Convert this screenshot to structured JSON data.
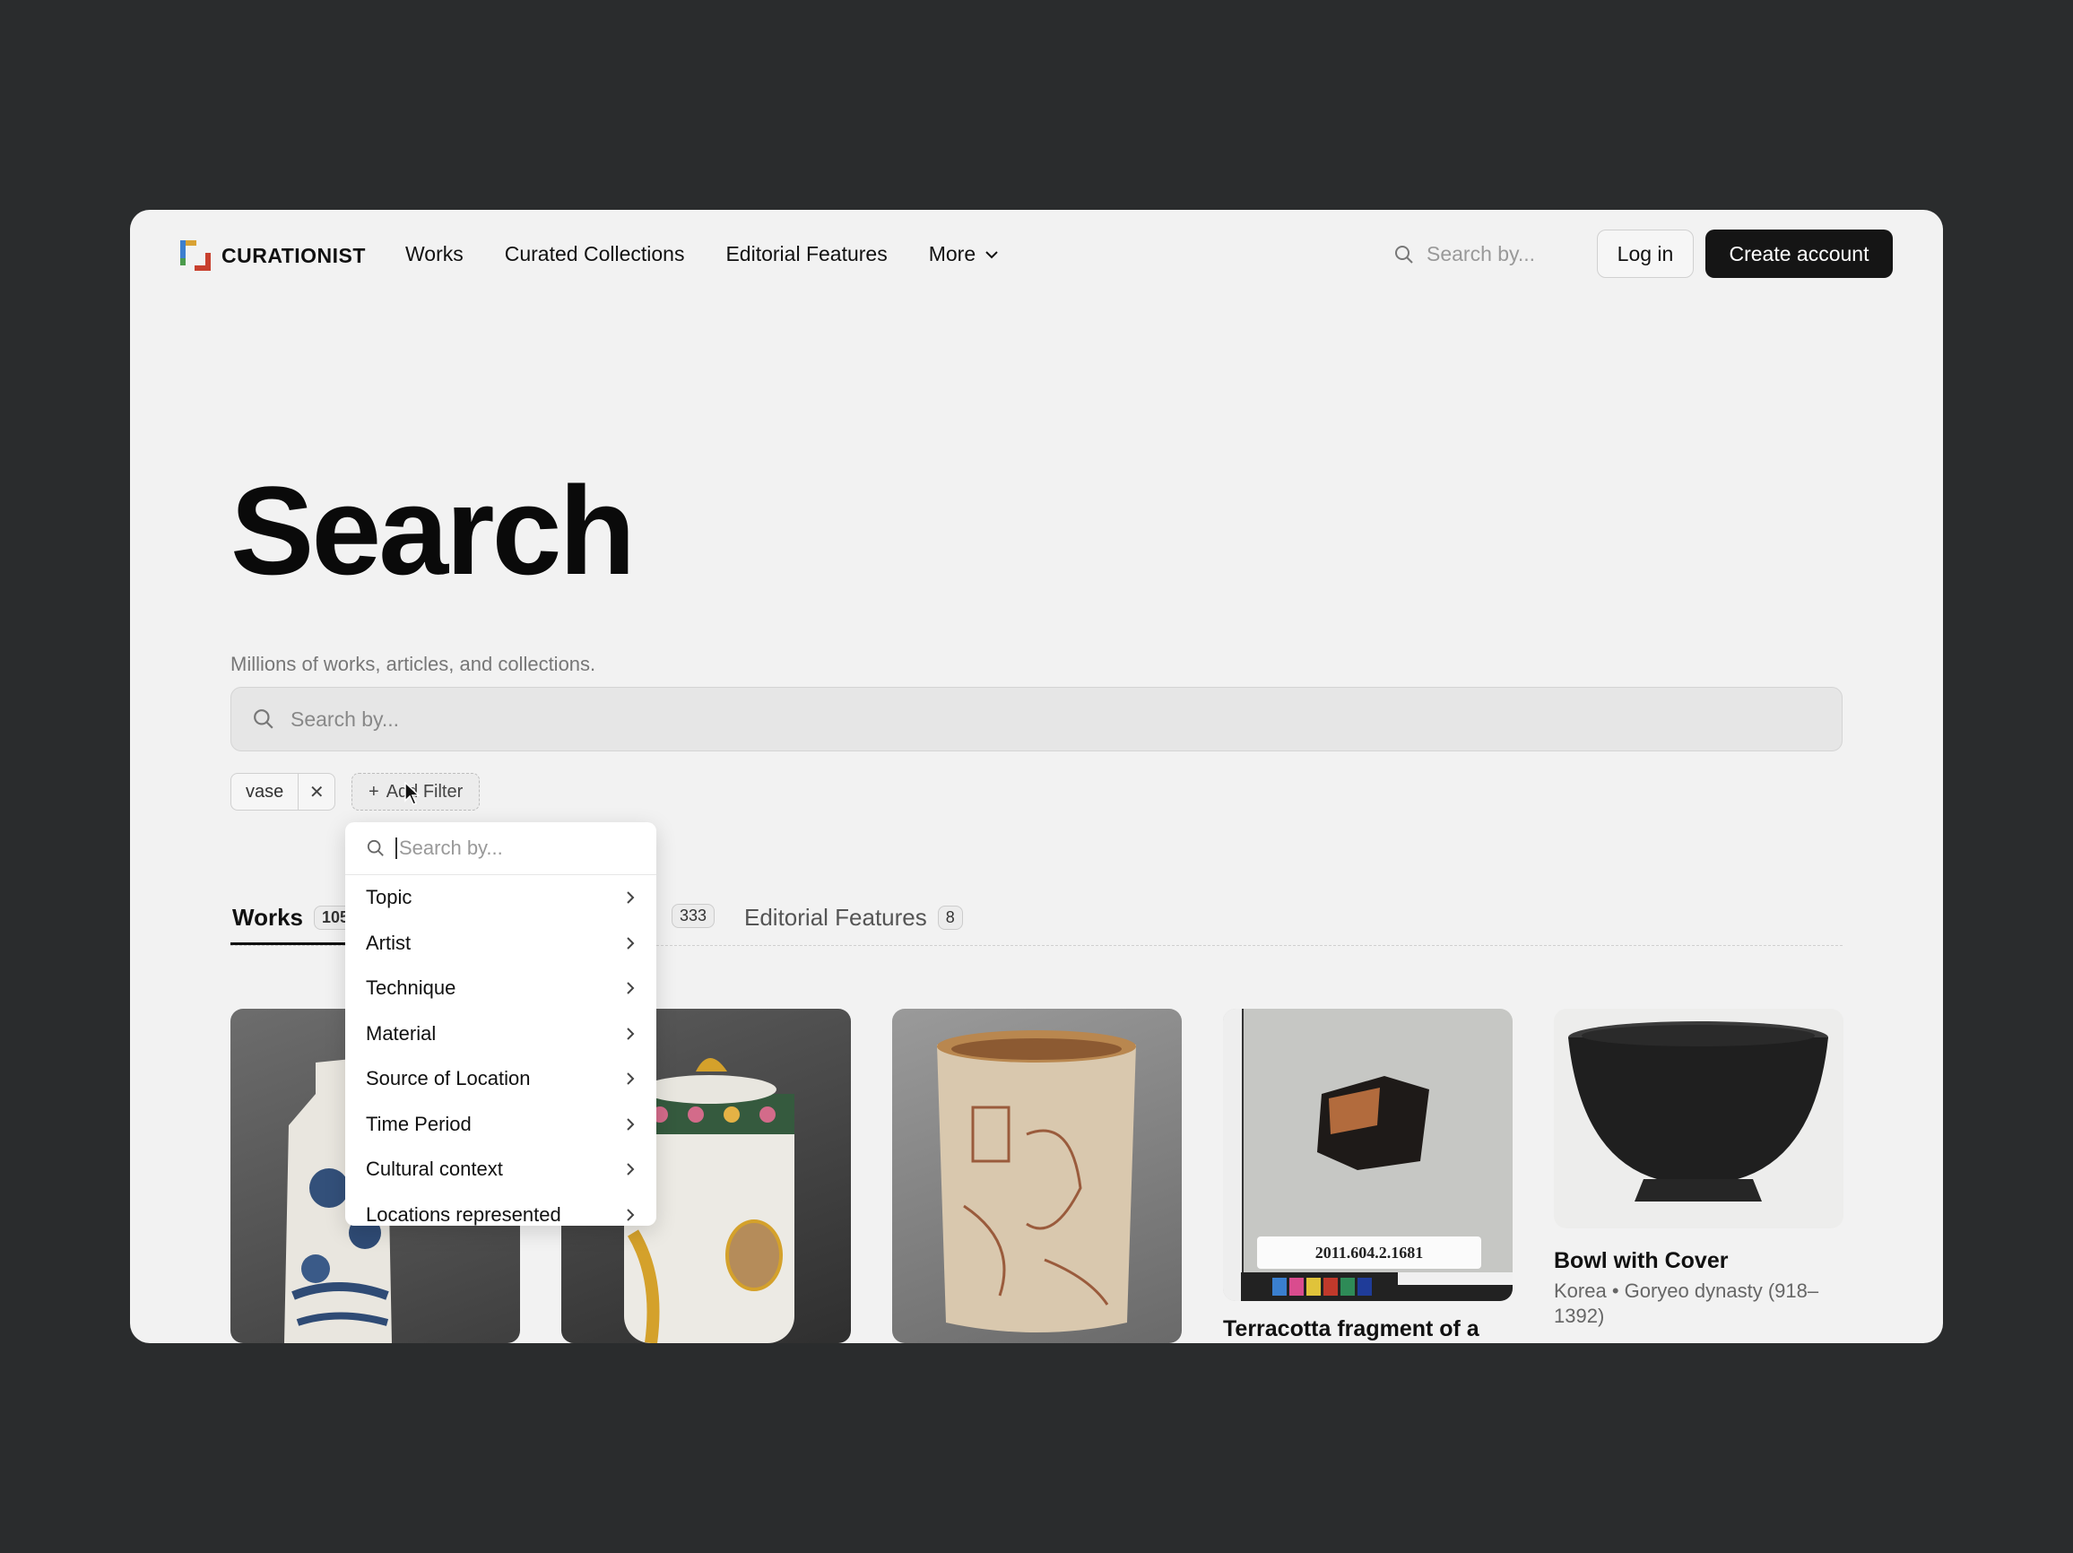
{
  "brand": {
    "name": "CURATIONIST"
  },
  "nav": {
    "items": [
      "Works",
      "Curated Collections",
      "Editorial Features"
    ],
    "more": "More"
  },
  "header": {
    "search_placeholder": "Search by...",
    "login": "Log in",
    "create_account": "Create account"
  },
  "page": {
    "title": "Search",
    "subtitle": "Millions of works, articles, and collections.",
    "search_placeholder": "Search by..."
  },
  "filters": {
    "active": [
      {
        "label": "vase"
      }
    ],
    "add_label": "Add Filter"
  },
  "dropdown": {
    "search_placeholder": "Search by...",
    "items": [
      "Topic",
      "Artist",
      "Technique",
      "Material",
      "Source of Location",
      "Time Period",
      "Cultural context",
      "Locations represented"
    ]
  },
  "tabs": [
    {
      "label": "Works",
      "count": "105"
    },
    {
      "label": "",
      "count": "333"
    },
    {
      "label": "Editorial Features",
      "count": "8"
    }
  ],
  "cards": [
    {
      "title": "",
      "meta": ""
    },
    {
      "title": "",
      "meta": ""
    },
    {
      "title": "",
      "meta": ""
    },
    {
      "title": "Terracotta fragment of a",
      "meta": "",
      "image_label": "2011.604.2.1681"
    },
    {
      "title": "Bowl with Cover",
      "meta": "Korea • Goryeo dynasty (918–1392)"
    }
  ],
  "colors": {
    "background": "#2a2c2d",
    "window": "#f2f2f2",
    "primary_button": "#151515",
    "logo": [
      "#d9a233",
      "#3d7fcf",
      "#c8402e",
      "#4b9b4c"
    ]
  }
}
